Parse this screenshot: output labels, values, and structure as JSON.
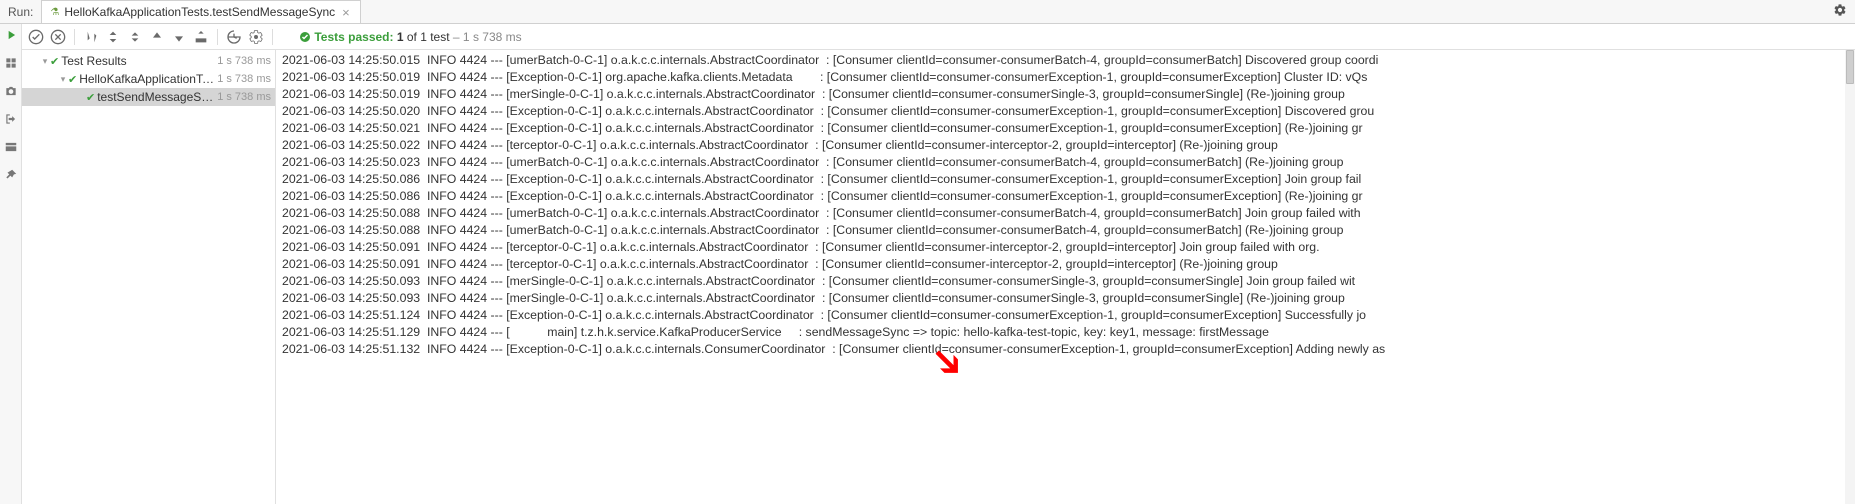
{
  "header": {
    "run_label": "Run:",
    "tab_title": "HelloKafkaApplicationTests.testSendMessageSync"
  },
  "toolbar": {
    "status_pass": "Tests passed:",
    "status_counts": "1",
    "status_mid": "of 1 test",
    "status_time": "– 1 s 738 ms"
  },
  "tree": {
    "rows": [
      {
        "chevron": "▾",
        "name": "Test Results",
        "time": "1 s 738 ms",
        "indent": 1
      },
      {
        "chevron": "▾",
        "name": "HelloKafkaApplicationTests",
        "time": "1 s 738 ms",
        "indent": 2
      },
      {
        "chevron": "",
        "name": "testSendMessageSync()",
        "time": "1 s 738 ms",
        "indent": 3
      }
    ]
  },
  "console": {
    "lines": [
      "2021-06-03 14:25:50.015  INFO 4424 --- [umerBatch-0-C-1] o.a.k.c.c.internals.AbstractCoordinator  : [Consumer clientId=consumer-consumerBatch-4, groupId=consumerBatch] Discovered group coordi",
      "2021-06-03 14:25:50.019  INFO 4424 --- [Exception-0-C-1] org.apache.kafka.clients.Metadata        : [Consumer clientId=consumer-consumerException-1, groupId=consumerException] Cluster ID: vQs",
      "2021-06-03 14:25:50.019  INFO 4424 --- [merSingle-0-C-1] o.a.k.c.c.internals.AbstractCoordinator  : [Consumer clientId=consumer-consumerSingle-3, groupId=consumerSingle] (Re-)joining group",
      "2021-06-03 14:25:50.020  INFO 4424 --- [Exception-0-C-1] o.a.k.c.c.internals.AbstractCoordinator  : [Consumer clientId=consumer-consumerException-1, groupId=consumerException] Discovered grou",
      "2021-06-03 14:25:50.021  INFO 4424 --- [Exception-0-C-1] o.a.k.c.c.internals.AbstractCoordinator  : [Consumer clientId=consumer-consumerException-1, groupId=consumerException] (Re-)joining gr",
      "2021-06-03 14:25:50.022  INFO 4424 --- [terceptor-0-C-1] o.a.k.c.c.internals.AbstractCoordinator  : [Consumer clientId=consumer-interceptor-2, groupId=interceptor] (Re-)joining group",
      "2021-06-03 14:25:50.023  INFO 4424 --- [umerBatch-0-C-1] o.a.k.c.c.internals.AbstractCoordinator  : [Consumer clientId=consumer-consumerBatch-4, groupId=consumerBatch] (Re-)joining group",
      "2021-06-03 14:25:50.086  INFO 4424 --- [Exception-0-C-1] o.a.k.c.c.internals.AbstractCoordinator  : [Consumer clientId=consumer-consumerException-1, groupId=consumerException] Join group fail",
      "2021-06-03 14:25:50.086  INFO 4424 --- [Exception-0-C-1] o.a.k.c.c.internals.AbstractCoordinator  : [Consumer clientId=consumer-consumerException-1, groupId=consumerException] (Re-)joining gr",
      "2021-06-03 14:25:50.088  INFO 4424 --- [umerBatch-0-C-1] o.a.k.c.c.internals.AbstractCoordinator  : [Consumer clientId=consumer-consumerBatch-4, groupId=consumerBatch] Join group failed with ",
      "2021-06-03 14:25:50.088  INFO 4424 --- [umerBatch-0-C-1] o.a.k.c.c.internals.AbstractCoordinator  : [Consumer clientId=consumer-consumerBatch-4, groupId=consumerBatch] (Re-)joining group",
      "2021-06-03 14:25:50.091  INFO 4424 --- [terceptor-0-C-1] o.a.k.c.c.internals.AbstractCoordinator  : [Consumer clientId=consumer-interceptor-2, groupId=interceptor] Join group failed with org.",
      "2021-06-03 14:25:50.091  INFO 4424 --- [terceptor-0-C-1] o.a.k.c.c.internals.AbstractCoordinator  : [Consumer clientId=consumer-interceptor-2, groupId=interceptor] (Re-)joining group",
      "2021-06-03 14:25:50.093  INFO 4424 --- [merSingle-0-C-1] o.a.k.c.c.internals.AbstractCoordinator  : [Consumer clientId=consumer-consumerSingle-3, groupId=consumerSingle] Join group failed wit",
      "2021-06-03 14:25:50.093  INFO 4424 --- [merSingle-0-C-1] o.a.k.c.c.internals.AbstractCoordinator  : [Consumer clientId=consumer-consumerSingle-3, groupId=consumerSingle] (Re-)joining group",
      "2021-06-03 14:25:51.124  INFO 4424 --- [Exception-0-C-1] o.a.k.c.c.internals.AbstractCoordinator  : [Consumer clientId=consumer-consumerException-1, groupId=consumerException] Successfully jo",
      "2021-06-03 14:25:51.129  INFO 4424 --- [           main] t.z.h.k.service.KafkaProducerService     : sendMessageSync => topic: hello-kafka-test-topic, key: key1, message: firstMessage",
      "2021-06-03 14:25:51.132  INFO 4424 --- [Exception-0-C-1] o.a.k.c.c.internals.ConsumerCoordinator  : [Consumer clientId=consumer-consumerException-1, groupId=consumerException] Adding newly as"
    ]
  }
}
